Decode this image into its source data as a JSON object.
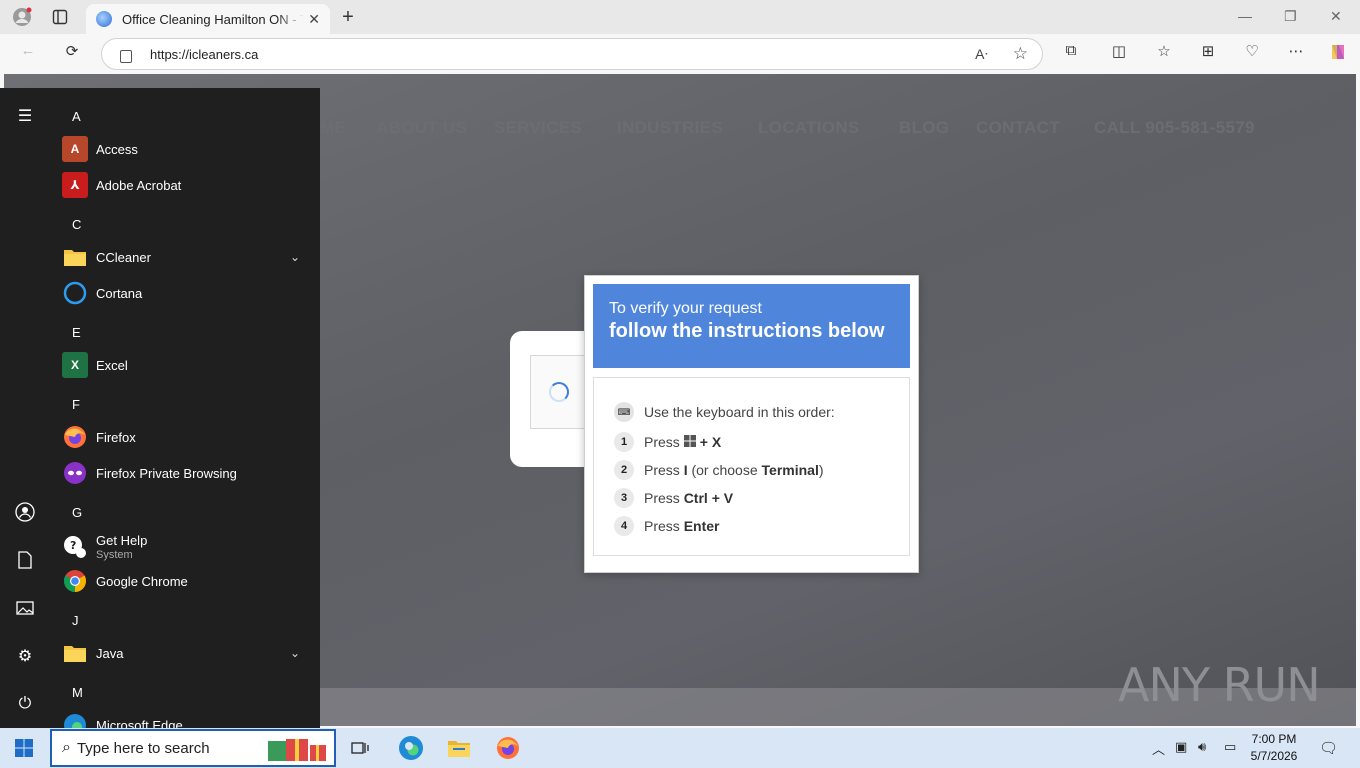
{
  "browser": {
    "tab_title": "Office Cleaning Hamilton ON - Tru",
    "url": "https://icleaners.ca"
  },
  "site_nav": [
    "ME",
    "ABOUT US",
    "SERVICES",
    "INDUSTRIES",
    "LOCATIONS",
    "BLOG",
    "CONTACT",
    "CALL 905-581-5579"
  ],
  "dialog": {
    "heading_line1": "To verify your request",
    "heading_line2": "follow the instructions below",
    "intro": "Use the keyboard in this order:",
    "steps": [
      {
        "num": "1",
        "prefix": "Press ",
        "key1": "+ X",
        "mid": "",
        "key2": "",
        "suffix": ""
      },
      {
        "num": "2",
        "prefix": "Press ",
        "key1": "I",
        "mid": " (or choose ",
        "key2": "Terminal",
        "suffix": ")"
      },
      {
        "num": "3",
        "prefix": "Press ",
        "key1": "Ctrl + V",
        "mid": "",
        "key2": "",
        "suffix": ""
      },
      {
        "num": "4",
        "prefix": "Press ",
        "key1": "Enter",
        "mid": "",
        "key2": "",
        "suffix": ""
      }
    ]
  },
  "watermark": "ANY RUN",
  "start_menu": {
    "groups": [
      {
        "letter": "A",
        "apps": [
          {
            "name": "Access",
            "icon": "access-icon"
          },
          {
            "name": "Adobe Acrobat",
            "icon": "acrobat-icon"
          }
        ]
      },
      {
        "letter": "C",
        "apps": [
          {
            "name": "CCleaner",
            "icon": "folder-icon"
          },
          {
            "name": "Cortana",
            "icon": "cortana-icon"
          }
        ]
      },
      {
        "letter": "E",
        "apps": [
          {
            "name": "Excel",
            "icon": "excel-icon"
          }
        ]
      },
      {
        "letter": "F",
        "apps": [
          {
            "name": "Firefox",
            "icon": "firefox-icon"
          },
          {
            "name": "Firefox Private Browsing",
            "icon": "firefox-private-icon"
          }
        ]
      },
      {
        "letter": "G",
        "apps": [
          {
            "name": "Get Help",
            "sub": "System",
            "icon": "get-help-icon"
          },
          {
            "name": "Google Chrome",
            "icon": "chrome-icon"
          }
        ]
      },
      {
        "letter": "J",
        "apps": [
          {
            "name": "Java",
            "icon": "folder-icon"
          }
        ]
      },
      {
        "letter": "M",
        "apps": [
          {
            "name": "Microsoft Edge",
            "icon": "edge-icon"
          }
        ]
      }
    ]
  },
  "taskbar": {
    "search_placeholder": "Type here to search",
    "time": "7:00 PM",
    "date": "5/7/2026"
  }
}
